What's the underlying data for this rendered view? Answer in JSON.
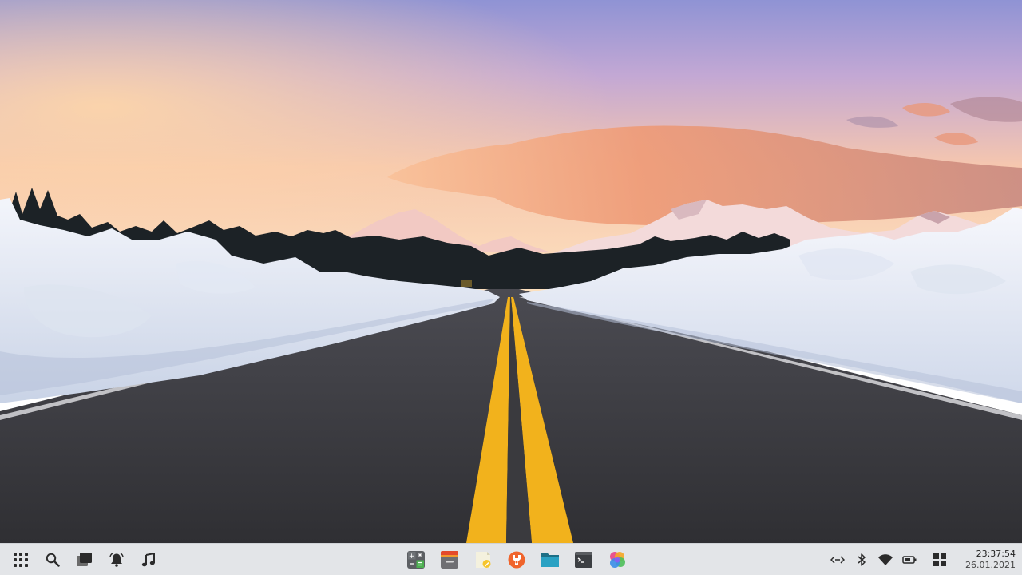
{
  "taskbar": {
    "left_icons": [
      {
        "name": "app-launcher-icon"
      },
      {
        "name": "search-icon"
      },
      {
        "name": "window-switcher-icon"
      },
      {
        "name": "notifications-icon"
      },
      {
        "name": "music-player-icon"
      }
    ],
    "pinned_apps": [
      {
        "name": "calculator-app-icon"
      },
      {
        "name": "archive-manager-app-icon"
      },
      {
        "name": "notes-app-icon"
      },
      {
        "name": "system-tools-app-icon"
      },
      {
        "name": "file-manager-app-icon"
      },
      {
        "name": "terminal-app-icon"
      },
      {
        "name": "color-picker-app-icon"
      }
    ],
    "tray": [
      {
        "name": "network-connections-icon"
      },
      {
        "name": "bluetooth-icon"
      },
      {
        "name": "wifi-icon"
      },
      {
        "name": "battery-icon"
      },
      {
        "name": "workspaces-icon"
      }
    ],
    "clock": {
      "time": "23:37:54",
      "date": "26.01.2021"
    }
  },
  "colors": {
    "taskbar_bg": "#e3e5e8",
    "icon_dark": "#2b2b2b",
    "road": "#3a3a3e",
    "road_line": "#f2b21c",
    "sky_top": "#9a9cd6",
    "sky_bottom": "#f7c9a0"
  }
}
